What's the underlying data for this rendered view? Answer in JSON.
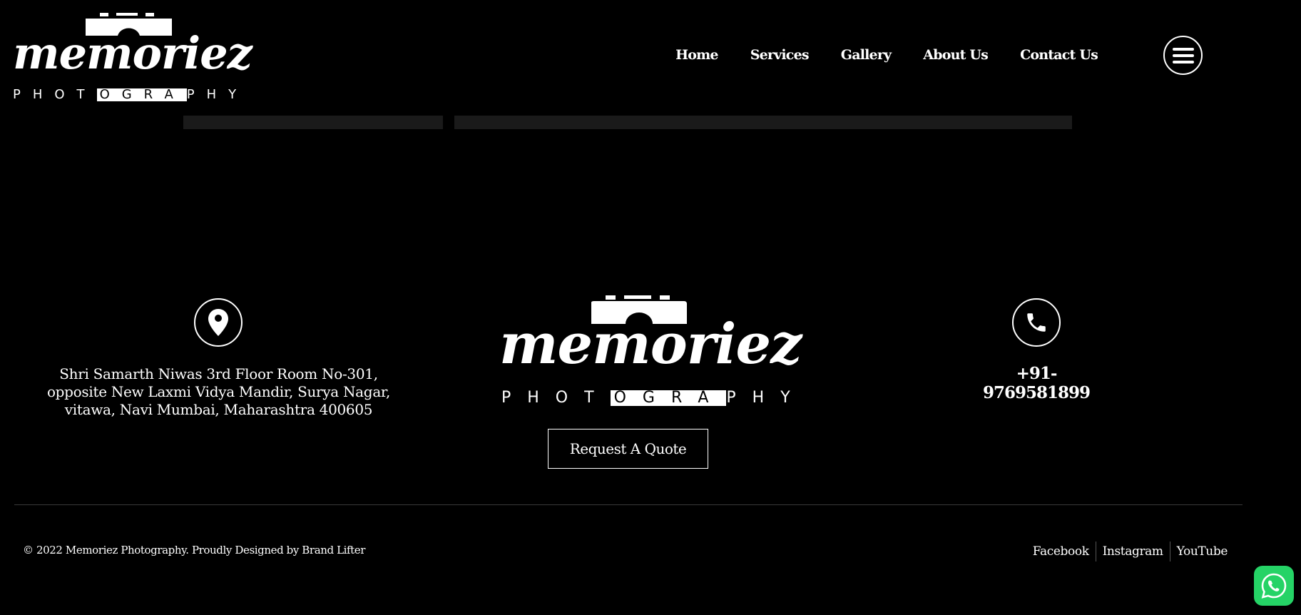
{
  "header": {
    "logo": {
      "script": "memoriez",
      "sub_pre": "PHOT",
      "sub_hl": "OGRA",
      "sub_post": "PHY"
    },
    "nav": [
      "Home",
      "Services",
      "Gallery",
      "About Us",
      "Contact Us"
    ],
    "menu_icon": "hamburger-menu-icon"
  },
  "footer": {
    "address": "Shri Samarth Niwas 3rd Floor Room No-301, opposite New Laxmi Vidya Mandir, Surya Nagar, vitawa, Navi Mumbai, Maharashtra 400605",
    "phone": "+91-9769581899",
    "logo": {
      "script": "memoriez",
      "sub_pre": "PHOT",
      "sub_hl": "OGRA",
      "sub_post": "PHY"
    },
    "quote_button": "Request A Quote",
    "copyright": "© 2022 Memoriez Photography. Proudly Designed by Brand Lifter",
    "social": [
      "Facebook",
      "Instagram",
      "YouTube"
    ]
  },
  "colors": {
    "background": "#000000",
    "text": "#ffffff",
    "whatsapp": "#25d366"
  }
}
